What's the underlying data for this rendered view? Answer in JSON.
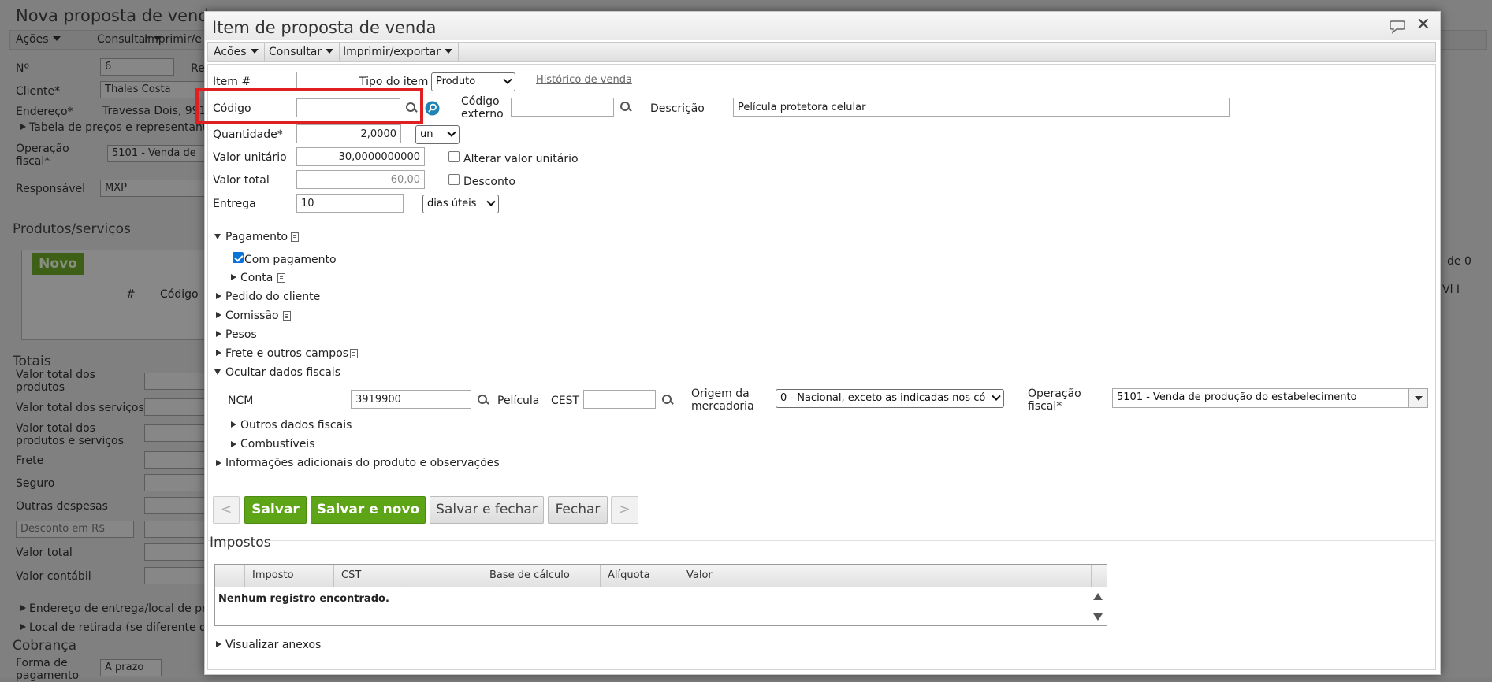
{
  "background": {
    "title": "Nova proposta de venda",
    "menu": [
      "Ações",
      "Consultar",
      "Imprimir/e"
    ],
    "fields": {
      "no_label": "Nº",
      "no_value": "6",
      "re_label": "Re",
      "cliente_label": "Cliente*",
      "cliente_value": "Thales Costa",
      "endereco_label": "Endereço*",
      "endereco_value": "Travessa Dois, 991",
      "tabela_label": "Tabela de preços e representante",
      "operacao_label": "Operação fiscal*",
      "operacao_value": "5101 - Venda de",
      "responsavel_label": "Responsável",
      "responsavel_value": "MXP"
    },
    "produtos_section": "Produtos/serviços",
    "novo_label": "Novo",
    "grid_hash": "#",
    "grid_codigo": "Código",
    "pager_text": "de 0",
    "vl_text": "Vl I",
    "totais_section": "Totais",
    "totais": [
      "Valor total dos produtos",
      "Valor total dos serviços",
      "Valor total dos produtos e serviços",
      "Frete",
      "Seguro",
      "Outras despesas",
      "Desconto em R$",
      "Valor total",
      "Valor contábil"
    ],
    "endereco_entrega": "Endereço de entrega/local de pre",
    "local_retirada": "Local de retirada (se diferente do",
    "cobranca_section": "Cobrança",
    "forma_pagamento_label": "Forma de pagamento",
    "forma_pagamento_value": "A prazo"
  },
  "dialog": {
    "title": "Item de proposta de venda",
    "menu": [
      "Ações",
      "Consultar",
      "Imprimir/exportar"
    ],
    "item_label": "Item #",
    "item_value": "",
    "tipo_label": "Tipo do item",
    "tipo_value": "Produto",
    "historico_link": "Histórico de venda",
    "codigo_label": "Código",
    "codigo_value": "",
    "codigo_externo_label": "Código externo",
    "codigo_externo_value": "",
    "descricao_label": "Descrição",
    "descricao_value": "Película protetora celular",
    "quantidade_label": "Quantidade*",
    "quantidade_value": "2,0000",
    "unidade_value": "un",
    "valor_unitario_label": "Valor unitário",
    "valor_unitario_value": "30,0000000000",
    "alterar_label": "Alterar valor unitário",
    "valor_total_label": "Valor total",
    "valor_total_value": "60,00",
    "desconto_label": "Desconto",
    "entrega_label": "Entrega",
    "entrega_value": "10",
    "entrega_unit": "dias úteis",
    "pagamento_label": "Pagamento",
    "com_pagamento_label": "Com pagamento",
    "conta_label": "Conta",
    "pedido_label": "Pedido do cliente",
    "comissao_label": "Comissão",
    "pesos_label": "Pesos",
    "frete_label": "Frete e outros campos",
    "ocultar_label": "Ocultar dados fiscais",
    "ncm_label": "NCM",
    "ncm_value": "3919900",
    "ncm_desc": "Película",
    "cest_label": "CEST",
    "cest_value": "",
    "origem_label": "Origem da mercadoria",
    "origem_value": "0 - Nacional, exceto as indicadas nos có",
    "operacao_label": "Operação fiscal*",
    "operacao_value": "5101 - Venda de produção do estabelecimento",
    "outros_fiscais_label": "Outros dados fiscais",
    "combustiveis_label": "Combustíveis",
    "info_adicionais_label": "Informações adicionais do produto e observações",
    "btn_prev": "<",
    "btn_salvar": "Salvar",
    "btn_salvar_novo": "Salvar e novo",
    "btn_salvar_fechar": "Salvar e fechar",
    "btn_fechar": "Fechar",
    "btn_next": ">",
    "impostos_section": "Impostos",
    "impostos_headers": [
      "Imposto",
      "CST",
      "Base de cálculo",
      "Alíquota",
      "Valor"
    ],
    "impostos_empty": "Nenhum registro encontrado.",
    "anexos_label": "Visualizar anexos"
  },
  "colors": {
    "green": "#5ea417",
    "highlight": "#e02020",
    "checkbox": "#0a73d8"
  }
}
